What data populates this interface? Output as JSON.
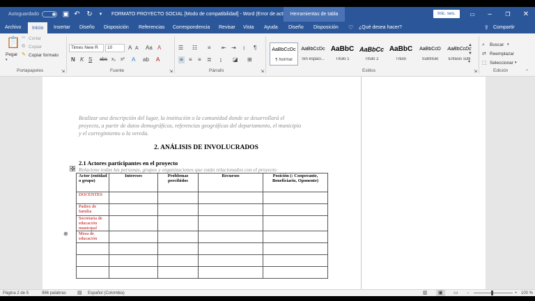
{
  "titlebar": {
    "autosave_label": "Autoguardado",
    "doc_title": "FORMATO PROYECTO SOCIAL [Modo de compatibilidad] - Word (Error de acti...",
    "context_tab": "Herramientas de tabla",
    "signin_label": "Inic. ses.",
    "minimize": "–",
    "restore": "❐",
    "close": "✕"
  },
  "tabs": {
    "archivo": "Archivo",
    "inicio": "Inicio",
    "insertar": "Insertar",
    "diseno": "Diseño",
    "disposicion": "Disposición",
    "referencias": "Referencias",
    "correspondencia": "Correspondencia",
    "revisar": "Revisar",
    "vista": "Vista",
    "ayuda": "Ayuda",
    "diseno_tabla": "Diseño",
    "disposicion_tabla": "Disposición",
    "tell_me": "¿Qué desea hacer?",
    "compartir": "Compartir"
  },
  "ribbon": {
    "clipboard": {
      "paste": "Pegar",
      "cut": "Cortar",
      "copy": "Copiar",
      "format_painter": "Copiar formato",
      "label": "Portapapeles"
    },
    "font": {
      "name": "Times New R",
      "size": "10",
      "label": "Fuente"
    },
    "paragraph": {
      "label": "Párrafo"
    },
    "styles": {
      "label": "Estilos",
      "items": [
        {
          "sample": "AaBbCcDc",
          "name": "¶ Normal"
        },
        {
          "sample": "AaBbCcDc",
          "name": "Sin espaci..."
        },
        {
          "sample": "AaBbC",
          "name": "Título 1"
        },
        {
          "sample": "AaBbCc",
          "name": "Título 2"
        },
        {
          "sample": "AaBbC",
          "name": "Título"
        },
        {
          "sample": "AaBbCcD",
          "name": "Subtítulo"
        },
        {
          "sample": "AaBbCcDc",
          "name": "Énfasis sutil"
        }
      ]
    },
    "editing": {
      "find": "Buscar",
      "replace": "Reemplazar",
      "select": "Seleccionar",
      "label": "Edición"
    }
  },
  "document": {
    "intro_lines": [
      "Realizar una descripción del lugar, la institución o la comunidad donde se desarrollará el",
      "proyecto, a partir de datos demográficos, referencias geográficas del departamento, el municipio",
      "y el corregimiento o la vereda."
    ],
    "section_heading": "2. ANÁLISIS DE INVOLUCRADOS",
    "subsection_heading": "2.1 Actores participantes en el proyecto",
    "subsection_hint": "Relacione todas las personas, grupos y organizaciones que están relacionados con el proyecto",
    "table": {
      "headers": [
        "Actor (entidad o grupo)",
        "Intereses",
        "Problemas percibidos",
        "Recursos",
        "Posición (: Cooperante, Beneficiario, Oponente)"
      ],
      "rows": [
        "DOCENTES",
        "Padres de familia",
        "Secretaria de educación municipal",
        "Mesa de educación",
        "",
        "",
        ""
      ]
    }
  },
  "status": {
    "page": "Página 2 de 5",
    "words": "966 palabras",
    "language": "Español (Colombia)",
    "zoom": "100 %"
  }
}
